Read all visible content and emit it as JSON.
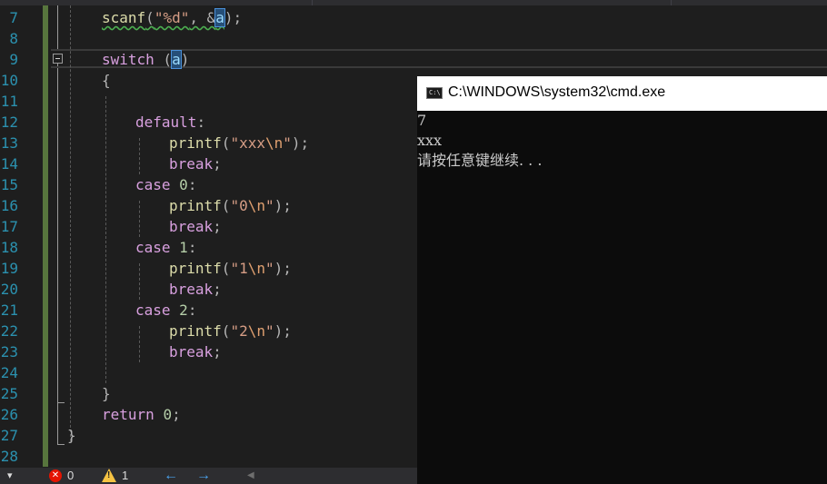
{
  "editor": {
    "line_numbers": [
      "7",
      "8",
      "9",
      "10",
      "11",
      "12",
      "13",
      "14",
      "15",
      "16",
      "17",
      "18",
      "19",
      "20",
      "21",
      "22",
      "23",
      "24",
      "25",
      "26",
      "27",
      "28"
    ],
    "code": {
      "l7_fn": "scanf",
      "l7_open": "(",
      "l7_str": "\"%d\"",
      "l7_mid": ", &",
      "l7_var": "a",
      "l7_end": ");",
      "l9_kw": "switch",
      "l9_open": " (",
      "l9_var": "a",
      "l9_close": ")",
      "l10": "{",
      "default_kw": "default",
      "colon": ":",
      "printf": "printf",
      "paren_open": "(",
      "quote": "\"",
      "str_xxx": "xxx",
      "esc_n": "\\n",
      "paren_close_semi": ");",
      "break_kw": "break",
      "semi": ";",
      "case_kw": "case",
      "num_0": "0",
      "num_1": "1",
      "num_2": "2",
      "l25": "}",
      "return_kw": "return",
      "l26_num": "0",
      "l27": "}"
    }
  },
  "console": {
    "title": "C:\\WINDOWS\\system32\\cmd.exe",
    "icon_label": "C:\\.",
    "lines": [
      "7",
      "xxx",
      "请按任意键继续. . ."
    ]
  },
  "statusbar": {
    "errors_count": "0",
    "warnings_count": "1",
    "back_arrow": "←",
    "forward_arrow": "→",
    "dropdown_arrow": "▾"
  },
  "colors": {
    "editor_bg": "#1e1e1e",
    "line_number": "#2b91af",
    "change_bar": "#57753d",
    "console_bg": "#0c0c0c",
    "error": "#e51400",
    "warning": "#f6c343"
  }
}
